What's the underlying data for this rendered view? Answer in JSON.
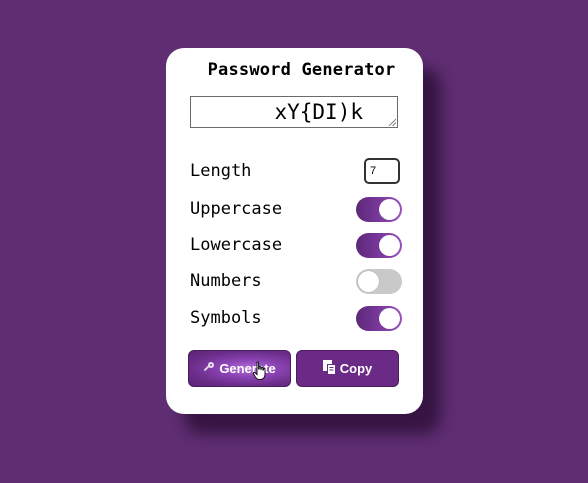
{
  "app": {
    "title": "Password Generator"
  },
  "output": {
    "value": "xY{DI)k"
  },
  "options": {
    "length_label": "Length",
    "length_value": "7",
    "uppercase_label": "Uppercase",
    "uppercase_on": true,
    "lowercase_label": "Lowercase",
    "lowercase_on": true,
    "numbers_label": "Numbers",
    "numbers_on": false,
    "symbols_label": "Symbols",
    "symbols_on": true
  },
  "actions": {
    "generate_label": "Generate",
    "generate_icon": "key-icon",
    "copy_label": "Copy",
    "copy_icon": "copy-icon"
  },
  "colors": {
    "background": "#5f2d72",
    "card": "#ffffff",
    "accent": "#7c3aa0",
    "toggle_off": "#c9c9c9"
  }
}
